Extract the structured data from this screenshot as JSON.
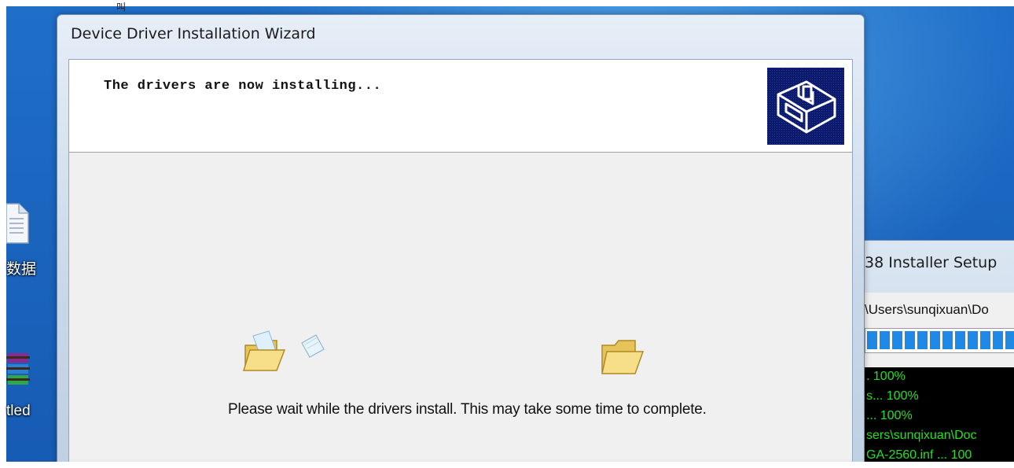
{
  "desktop": {
    "top_glyph": "叫",
    "icons": [
      {
        "label": "数据",
        "icon": "document-icon"
      },
      {
        "label": "tled",
        "icon": "winrar-archive-icon"
      }
    ]
  },
  "wizard": {
    "title": "Device Driver Installation Wizard",
    "header_text": "The drivers are now installing...",
    "logo_icon": "hardware-drive-icon",
    "wait_message": "Please wait while the drivers install. This may take some time to complete.",
    "animation": {
      "source_icon": "open-folder-icon",
      "moving_icon": "flying-paper-icon",
      "target_icon": "folder-icon"
    }
  },
  "installer_window": {
    "title": "38 Installer Setup",
    "path": "\\Users\\sunqixuan\\Do",
    "progress": 1.0,
    "progress_color": "#1e8ae6",
    "console_color": "#22e022",
    "console_lines": [
      ". 100%",
      "s... 100%",
      "... 100%",
      "sers\\sunqixuan\\Doc",
      "GA-2560.inf ... 100"
    ]
  }
}
